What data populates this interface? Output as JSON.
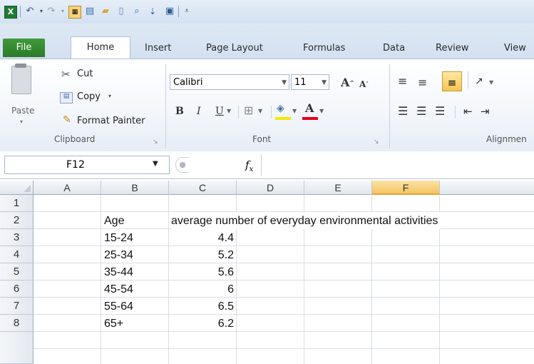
{
  "quick_access": {
    "icons": [
      "excel-logo-icon",
      "undo-icon",
      "redo-icon",
      "new-chart-icon",
      "form-icon",
      "open-icon",
      "new-icon",
      "print-preview-icon",
      "sort-icon",
      "save-icon",
      "customize-icon"
    ]
  },
  "tabs": [
    "File",
    "Home",
    "Insert",
    "Page Layout",
    "Formulas",
    "Data",
    "Review",
    "View"
  ],
  "active_tab": "Home",
  "clipboard": {
    "paste_label": "Paste",
    "cut_label": "Cut",
    "copy_label": "Copy",
    "format_painter_label": "Format Painter",
    "group_label": "Clipboard"
  },
  "font": {
    "font_name": "Calibri",
    "font_size": "11",
    "group_label": "Font",
    "bold": "B",
    "italic": "I",
    "underline": "U",
    "font_color_letter": "A"
  },
  "alignment": {
    "group_label": "Alignmen"
  },
  "formula_bar": {
    "name_box": "F12",
    "fx": "fx",
    "formula": ""
  },
  "columns": [
    "A",
    "B",
    "C",
    "D",
    "E",
    "F"
  ],
  "selected_column": "F",
  "rows": [
    "1",
    "2",
    "3",
    "4",
    "5",
    "6",
    "7",
    "8"
  ],
  "cells": {
    "B2": "Age",
    "C2": "average number of everyday environmental activities",
    "B3": "15-24",
    "C3": "4.4",
    "B4": "25-34",
    "C4": "5.2",
    "B5": "35-44",
    "C5": "5.6",
    "B6": "45-54",
    "C6": "6",
    "B7": "55-64",
    "C7": "6.5",
    "B8": "65+",
    "C8": "6.2"
  },
  "colors": {
    "file_tab": "#2c7a2a",
    "selection": "#f3c560",
    "ribbon_bg": "#dfe9f5"
  }
}
